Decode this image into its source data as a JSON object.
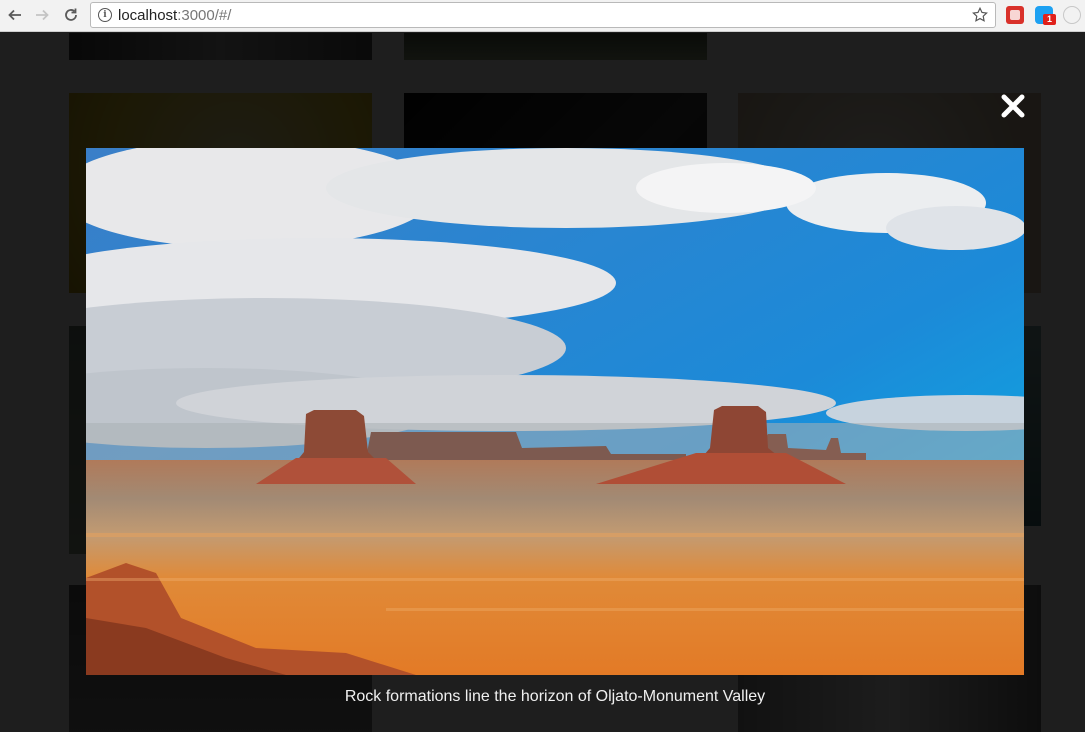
{
  "browser": {
    "url_host": "localhost",
    "url_rest": ":3000/#/",
    "extension_badge": "1"
  },
  "lightbox": {
    "caption": "Rock formations line the horizon of Oljato-Monument Valley",
    "close_icon": "close-icon"
  },
  "colors": {
    "overlay": "#000000e0",
    "sky": "#1f86d6",
    "desert": "#e07a2a"
  }
}
